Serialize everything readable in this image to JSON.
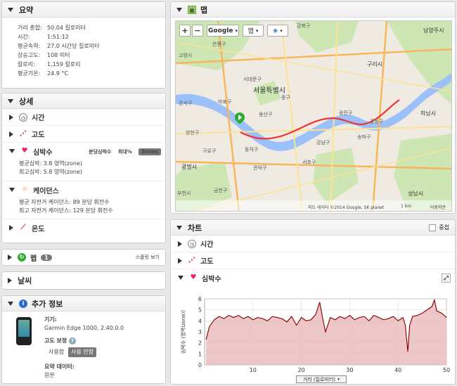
{
  "summary": {
    "title": "요약",
    "rows": [
      {
        "k": "거리 총합:",
        "v": "50.04 킬로미터"
      },
      {
        "k": "시간:",
        "v": "1:51:12"
      },
      {
        "k": "평균속력:",
        "v": "27.0 시간당 킬로미터"
      },
      {
        "k": "상승고도:",
        "v": "108 미터"
      },
      {
        "k": "칼로리:",
        "v": "1,159 칼로리"
      },
      {
        "k": "평균기온:",
        "v": "24.9 °C"
      }
    ]
  },
  "details": {
    "title": "상세",
    "time": "시간",
    "elevation": "고도",
    "heart": {
      "label": "심박수",
      "tab1": "분당심박수",
      "tab2": "최대%",
      "tab3": "Zones",
      "avg": "평균심박: 3.8 영역(zone)",
      "max": "최고심박: 5.8 영역(zone)"
    },
    "cadence": {
      "label": "케이던스",
      "avg": "평균 자전거 케이던스: 89 분당 회전수",
      "max": "최고 자전거 케이던스: 129 분당 회전수"
    },
    "temperature": "온도"
  },
  "laps": {
    "label": "랩",
    "count": "1",
    "link": "스플릿 보기"
  },
  "weather": {
    "label": "날씨"
  },
  "extra": {
    "title": "추가 정보",
    "device_label": "기기:",
    "device_value": "Garmin Edge 1000, 2.40.0.0",
    "elev_label": "고도 보정",
    "elev_help": "?",
    "opt_used": "사용함",
    "opt_unused": "사용 안함",
    "summary_label": "요약 데이터:",
    "summary_value": "원본"
  },
  "map": {
    "title": "맵",
    "plus": "+",
    "minus": "−",
    "provider": "Google",
    "type_btn": "맵",
    "attribution": "지도 데이터 ©2014 Google, SK planet",
    "scale": "1 km",
    "terms": "이용약관",
    "city": "서울특별시",
    "places": [
      {
        "name": "강북구"
      },
      {
        "name": "남양주시"
      },
      {
        "name": "구리시"
      },
      {
        "name": "하남시"
      },
      {
        "name": "은평구"
      },
      {
        "name": "서대문구"
      },
      {
        "name": "마포구"
      },
      {
        "name": "중구"
      },
      {
        "name": "용산구"
      },
      {
        "name": "광진구"
      },
      {
        "name": "강동구"
      },
      {
        "name": "송파구"
      },
      {
        "name": "강남구"
      },
      {
        "name": "서초구"
      },
      {
        "name": "관악구"
      },
      {
        "name": "동작구"
      },
      {
        "name": "구로구"
      },
      {
        "name": "양천구"
      },
      {
        "name": "강서구"
      },
      {
        "name": "광명시"
      },
      {
        "name": "금천구"
      },
      {
        "name": "성남시"
      },
      {
        "name": "부천시"
      },
      {
        "name": "고양시"
      }
    ]
  },
  "chart_panel": {
    "title": "차트",
    "toggle": "중첩",
    "time": "시간",
    "elevation": "고도",
    "heart": "심박수",
    "selector": "거리 (킬로미터)"
  },
  "chart_data": {
    "type": "area",
    "xlabel": "거리 (킬로미터)",
    "ylabel": "심박수 (영역(zone))",
    "xlim": [
      0,
      50
    ],
    "ylim": [
      0,
      6
    ],
    "xticks": [
      10,
      20,
      30,
      40,
      50
    ],
    "yticks": [
      0,
      1,
      2,
      3,
      4,
      5,
      6
    ],
    "colors": {
      "line": "#8b0a0a",
      "fill": "#e8b9b9"
    },
    "x": [
      0.3,
      1,
      2,
      3,
      4,
      5,
      6,
      7,
      8,
      9,
      10,
      11,
      12,
      13,
      14,
      15,
      16,
      17,
      18,
      19,
      20,
      21,
      22,
      23,
      23.8,
      24.5,
      25,
      26,
      27,
      28,
      29,
      30,
      31,
      32,
      33,
      34,
      35,
      36,
      37,
      38,
      39,
      40,
      41,
      41.5,
      42,
      42.4,
      43,
      44,
      45,
      46,
      47,
      47.5,
      48,
      49,
      50
    ],
    "y": [
      2.3,
      3.5,
      4.1,
      4.4,
      4.2,
      4.5,
      4.3,
      4.5,
      4.2,
      4.4,
      4.1,
      4.3,
      4.2,
      4.0,
      4.4,
      4.3,
      4.2,
      3.9,
      4.4,
      3.6,
      4.3,
      4.0,
      4.1,
      4.6,
      5.7,
      4.0,
      3.0,
      4.3,
      4.1,
      4.4,
      4.2,
      4.5,
      4.1,
      4.3,
      4.4,
      4.0,
      4.5,
      4.3,
      4.1,
      4.2,
      4.4,
      4.0,
      4.3,
      3.6,
      1.2,
      3.6,
      4.4,
      4.5,
      4.7,
      5.0,
      5.3,
      5.9,
      4.9,
      4.7,
      4.3
    ]
  }
}
